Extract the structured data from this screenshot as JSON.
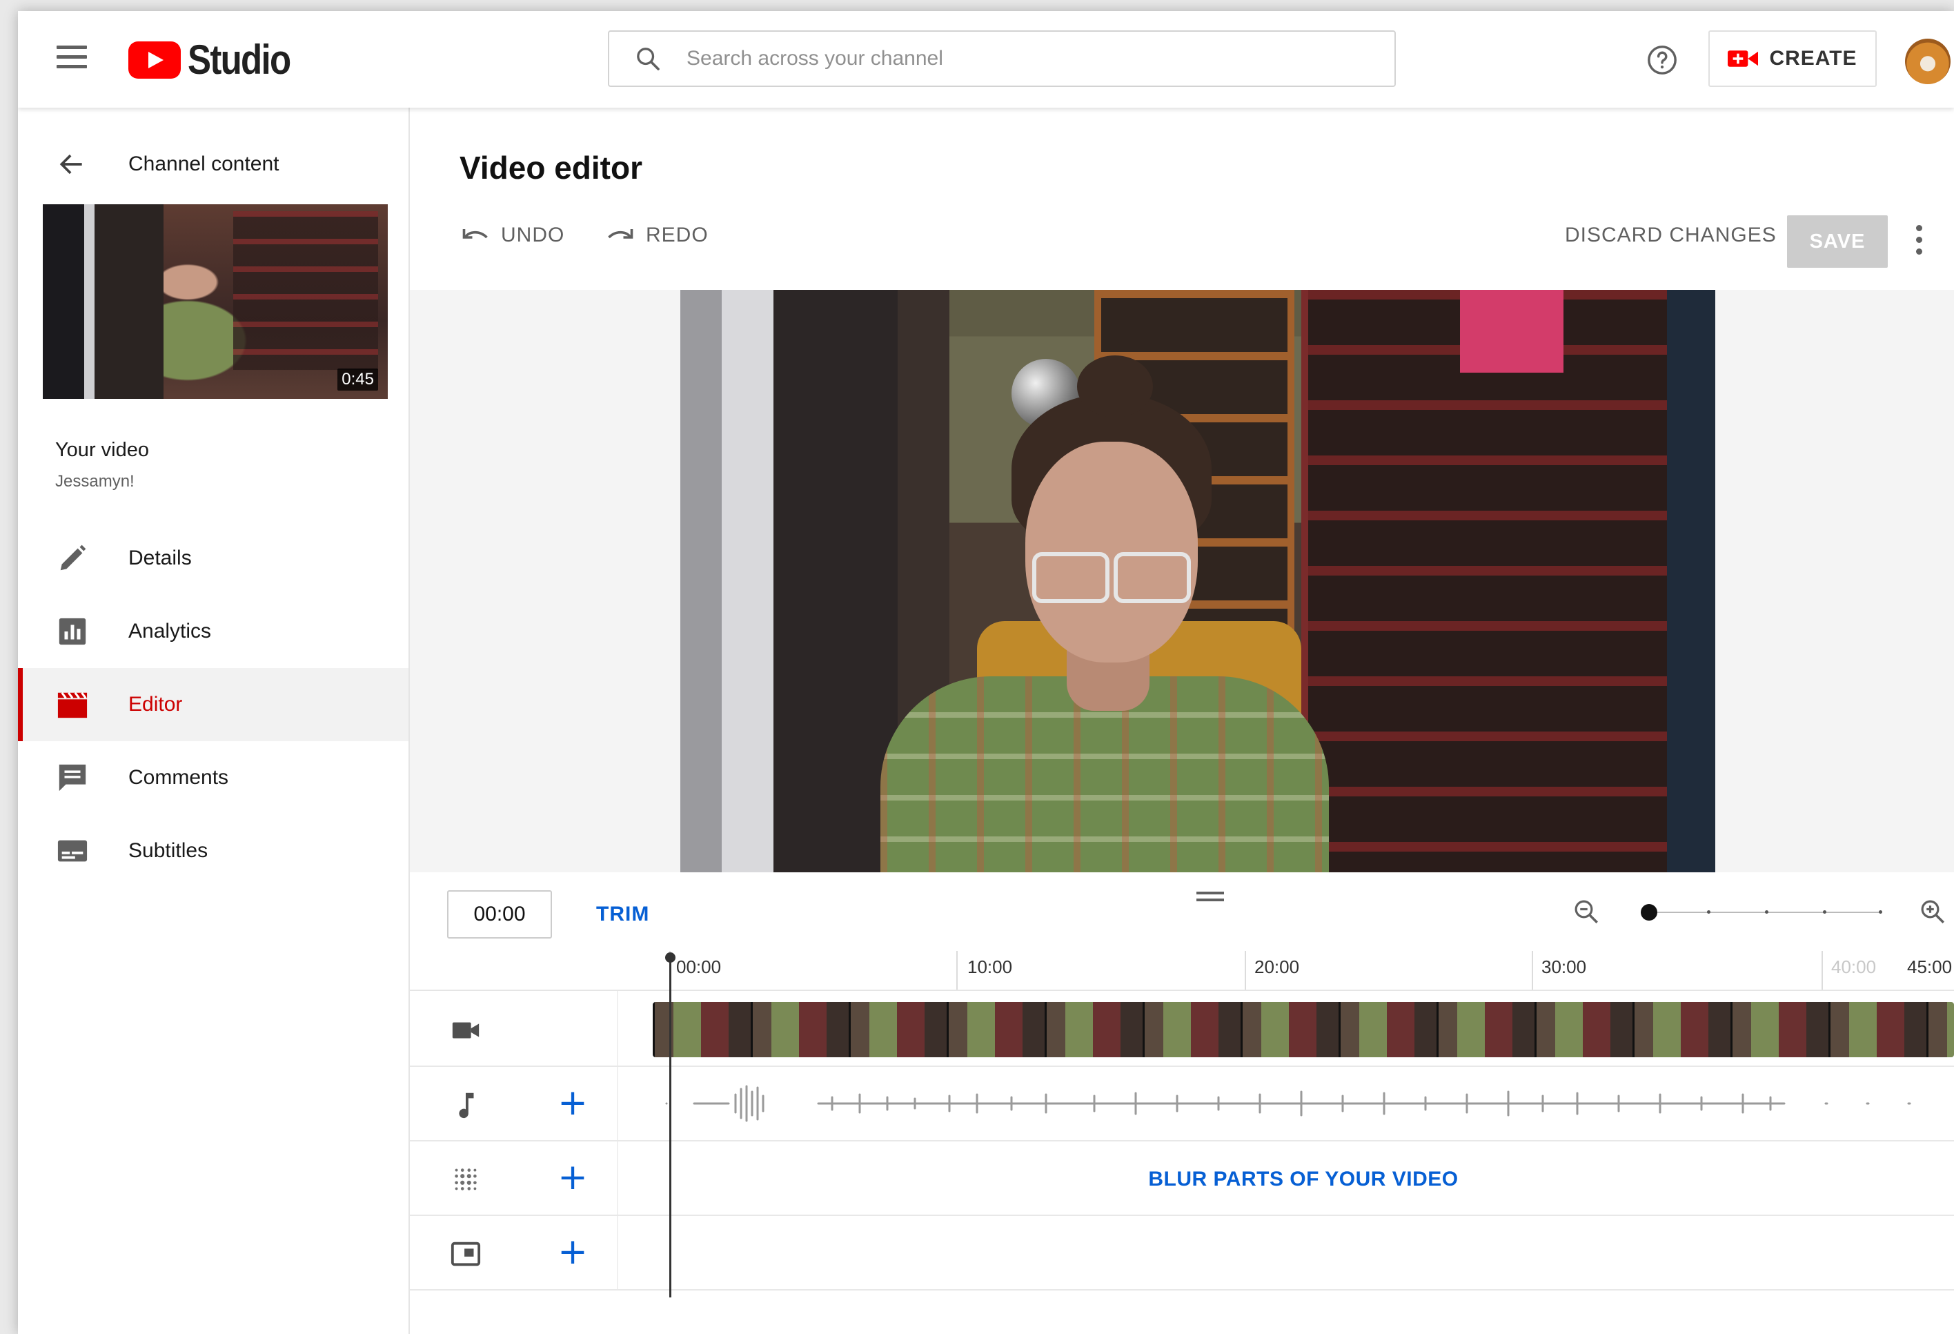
{
  "header": {
    "logo_text": "Studio",
    "search_placeholder": "Search across your channel",
    "create_label": "CREATE"
  },
  "sidebar": {
    "back_label": "Channel content",
    "thumbnail_duration": "0:45",
    "your_video_label": "Your video",
    "channel_name": "Jessamyn!",
    "items": [
      {
        "label": "Details",
        "icon": "pencil-icon"
      },
      {
        "label": "Analytics",
        "icon": "analytics-icon"
      },
      {
        "label": "Editor",
        "icon": "clapperboard-icon",
        "active": true
      },
      {
        "label": "Comments",
        "icon": "comment-icon"
      },
      {
        "label": "Subtitles",
        "icon": "subtitles-icon"
      }
    ]
  },
  "editor": {
    "title": "Video editor",
    "undo_label": "UNDO",
    "redo_label": "REDO",
    "discard_label": "DISCARD CHANGES",
    "save_label": "SAVE"
  },
  "timeline": {
    "current_time": "00:00",
    "trim_label": "TRIM",
    "zoom_level": 0,
    "ruler_labels": [
      {
        "text": "00:00",
        "faded": false
      },
      {
        "text": "10:00",
        "faded": false
      },
      {
        "text": "20:00",
        "faded": false
      },
      {
        "text": "30:00",
        "faded": false
      },
      {
        "text": "40:00",
        "faded": true
      },
      {
        "text": "45:00",
        "faded": false
      }
    ],
    "blur_label": "BLUR PARTS OF YOUR VIDEO"
  },
  "colors": {
    "brand_red": "#ff0000",
    "active_red": "#cc0000",
    "link_blue": "#065fd4",
    "save_disabled": "#cccccc"
  }
}
